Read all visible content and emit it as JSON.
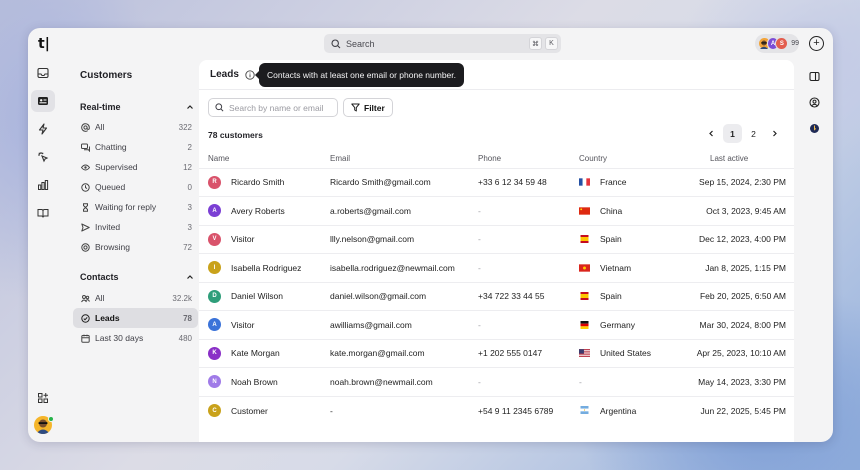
{
  "app": {
    "logo": "t|"
  },
  "search": {
    "label": "Search",
    "kbd": [
      "⌘",
      "K"
    ]
  },
  "avatars": {
    "items": [
      {
        "initial": "",
        "color": "#f2a43a",
        "icon": "face-avatar"
      },
      {
        "initial": "A",
        "color": "#7c4dd6"
      },
      {
        "initial": "S",
        "color": "#e35d4e"
      }
    ],
    "count": "99"
  },
  "rail": {
    "icons": [
      "inbox-icon",
      "contacts-icon",
      "lightning-icon",
      "sparkle-click-icon",
      "chart-bar-icon",
      "book-icon",
      "apps-add-icon",
      "settings-icon"
    ]
  },
  "sidebar": {
    "title": "Customers",
    "realtime": {
      "heading": "Real-time",
      "items": [
        {
          "label": "All",
          "count": "322",
          "icon": "at-icon"
        },
        {
          "label": "Chatting",
          "count": "2",
          "icon": "chat-icon"
        },
        {
          "label": "Supervised",
          "count": "12",
          "icon": "eye-icon"
        },
        {
          "label": "Queued",
          "count": "0",
          "icon": "clock-icon"
        },
        {
          "label": "Waiting for reply",
          "count": "3",
          "icon": "hourglass-icon"
        },
        {
          "label": "Invited",
          "count": "3",
          "icon": "send-icon"
        },
        {
          "label": "Browsing",
          "count": "72",
          "icon": "globe-icon"
        }
      ]
    },
    "contacts": {
      "heading": "Contacts",
      "items": [
        {
          "label": "All",
          "count": "32.2k",
          "icon": "people-icon"
        },
        {
          "label": "Leads",
          "count": "78",
          "icon": "check-circle-icon",
          "active": true
        },
        {
          "label": "Last 30 days",
          "count": "480",
          "icon": "calendar-icon"
        }
      ]
    }
  },
  "main": {
    "title": "Leads",
    "tooltip": "Contacts with at least one email or phone number.",
    "search_placeholder": "Search by name or email",
    "filter_label": "Filter",
    "count_label": "78 customers",
    "pages": [
      "1",
      "2"
    ],
    "columns": [
      "Name",
      "Email",
      "Phone",
      "Country",
      "Last active"
    ],
    "rows": [
      {
        "initial": "R",
        "color": "#d9536b",
        "name": "Ricardo Smith",
        "email": "Ricardo Smith@gmail.com",
        "phone_prefix": "+33",
        "phone": "6 12 34 59 48",
        "flag": "fr",
        "country": "France",
        "last": "Sep 15, 2024, 2:30 PM"
      },
      {
        "initial": "A",
        "color": "#7b3fd4",
        "name": "Avery Roberts",
        "email": "a.roberts@gmail.com",
        "phone_prefix": "",
        "phone": "-",
        "flag": "cn",
        "country": "China",
        "last": "Oct 3, 2023, 9:45 AM"
      },
      {
        "initial": "V",
        "color": "#d9536b",
        "name": "Visitor",
        "email": "llly.nelson@gmail.com",
        "phone_prefix": "",
        "phone": "-",
        "flag": "es",
        "country": "Spain",
        "last": "Dec 12, 2023, 4:00 PM"
      },
      {
        "initial": "I",
        "color": "#c9a21b",
        "name": "Isabella Rodriguez",
        "email": "isabella.rodriguez@newmail.com",
        "phone_prefix": "",
        "phone": "-",
        "flag": "vn",
        "country": "Vietnam",
        "last": "Jan 8, 2025, 1:15 PM"
      },
      {
        "initial": "D",
        "color": "#2f9e7a",
        "name": "Daniel Wilson",
        "email": "daniel.wilson@gmail.com",
        "phone_prefix": "+34",
        "phone": "722 33 44 55",
        "flag": "es",
        "country": "Spain",
        "last": "Feb 20, 2025, 6:50 AM"
      },
      {
        "initial": "A",
        "color": "#3b73d9",
        "name": "Visitor",
        "email": "awilliams@gmail.com",
        "phone_prefix": "",
        "phone": "-",
        "flag": "de",
        "country": "Germany",
        "last": "Mar 30, 2024, 8:00 PM"
      },
      {
        "initial": "K",
        "color": "#8a2fc7",
        "name": "Kate Morgan",
        "email": "kate.morgan@gmail.com",
        "phone_prefix": "+1",
        "phone": "202 555 0147",
        "flag": "us",
        "country": "United States",
        "last": "Apr 25, 2023, 10:10 AM"
      },
      {
        "initial": "N",
        "color": "#a07be8",
        "name": "Noah Brown",
        "email": "noah.brown@newmail.com",
        "phone_prefix": "",
        "phone": "-",
        "flag": "",
        "country": "-",
        "last": "May 14, 2023, 3:30 PM"
      },
      {
        "initial": "C",
        "color": "#c9a21b",
        "name": "Customer",
        "email": "-",
        "phone_prefix": "+54",
        "phone": "9 11 2345 6789",
        "flag": "ar",
        "country": "Argentina",
        "last": "Jun 22, 2025, 5:45 PM"
      }
    ]
  }
}
